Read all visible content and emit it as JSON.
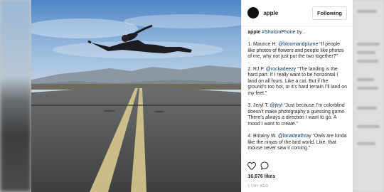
{
  "post": {
    "username": "apple",
    "follow_label": "Following",
    "avatar_glyph": "",
    "caption": {
      "author": "apple",
      "hashtag": "#ShotoniPhone",
      "intro": "by...",
      "dash": "-",
      "items": [
        {
          "prefix": "1. Maurice H.",
          "handle": "@bloomandplume",
          "quote": "“If people like photos of flowers and people like photos of me, why not just put the two together?”"
        },
        {
          "prefix": "2. RJ P.",
          "handle": "@rockadeezy",
          "quote": "“The landing is the hard part. If I really want to be horizontal I land on all fours. Like a cat. But if the ground’s too hot, or it’s hard terrain I’ll land on my feet.”"
        },
        {
          "prefix": "3. Jeryl T.",
          "handle": "@jtryl",
          "quote": "“Just because I’m colorblind doesn’t make photography a guessing game. There’s always a direction I want to go. A mood I want to create.”"
        },
        {
          "prefix": "4. Britainy W.",
          "handle": "@lanadeathray",
          "quote": "“Owls are kinda like the ninjas of the bird world. Like, that mouse never saw it coming.”"
        }
      ]
    },
    "likes": "16,676 likes",
    "time": "1 DAY AGO",
    "icons": {
      "like": "heart-icon",
      "comment": "comment-icon"
    }
  }
}
